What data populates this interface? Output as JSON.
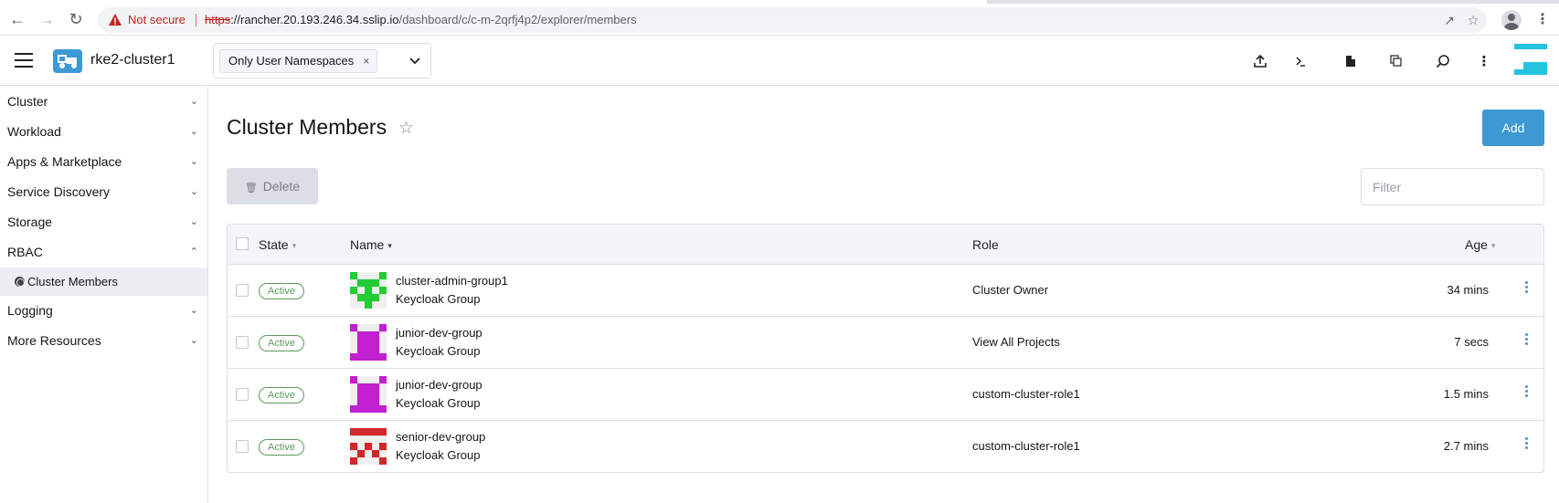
{
  "browser": {
    "security_label": "Not secure",
    "url_scheme": "https",
    "url_host": "://rancher.20.193.246.34.sslip.io",
    "url_path": "/dashboard/c/c-m-2qrfj4p2/explorer/members"
  },
  "header": {
    "cluster_name": "rke2-cluster1",
    "namespace_filter": "Only User Namespaces",
    "namespace_remove": "×"
  },
  "sidebar": {
    "items": [
      {
        "label": "Cluster",
        "expanded": false
      },
      {
        "label": "Workload",
        "expanded": false
      },
      {
        "label": "Apps & Marketplace",
        "expanded": false
      },
      {
        "label": "Service Discovery",
        "expanded": false
      },
      {
        "label": "Storage",
        "expanded": false
      },
      {
        "label": "RBAC",
        "expanded": true
      },
      {
        "label": "Logging",
        "expanded": false
      },
      {
        "label": "More Resources",
        "expanded": false
      }
    ],
    "rbac_sub": {
      "label": "Cluster Members",
      "selected": true
    }
  },
  "main": {
    "title": "Cluster Members",
    "add_label": "Add",
    "delete_label": "Delete",
    "filter_placeholder": "Filter",
    "columns": {
      "state": "State",
      "name": "Name",
      "role": "Role",
      "age": "Age"
    },
    "rows": [
      {
        "state": "Active",
        "name": "cluster-admin-group1",
        "provider": "Keycloak Group",
        "role": "Cluster Owner",
        "age": "34 mins",
        "avatar_color": "#22cc33"
      },
      {
        "state": "Active",
        "name": "junior-dev-group",
        "provider": "Keycloak Group",
        "role": "View All Projects",
        "age": "7 secs",
        "avatar_color": "#c020d0"
      },
      {
        "state": "Active",
        "name": "junior-dev-group",
        "provider": "Keycloak Group",
        "role": "custom-cluster-role1",
        "age": "1.5 mins",
        "avatar_color": "#c020d0"
      },
      {
        "state": "Active",
        "name": "senior-dev-group",
        "provider": "Keycloak Group",
        "role": "custom-cluster-role1",
        "age": "2.7 mins",
        "avatar_color": "#d02828"
      }
    ]
  },
  "colors": {
    "accent": "#3d98d3",
    "active_badge": "#5d995d"
  }
}
